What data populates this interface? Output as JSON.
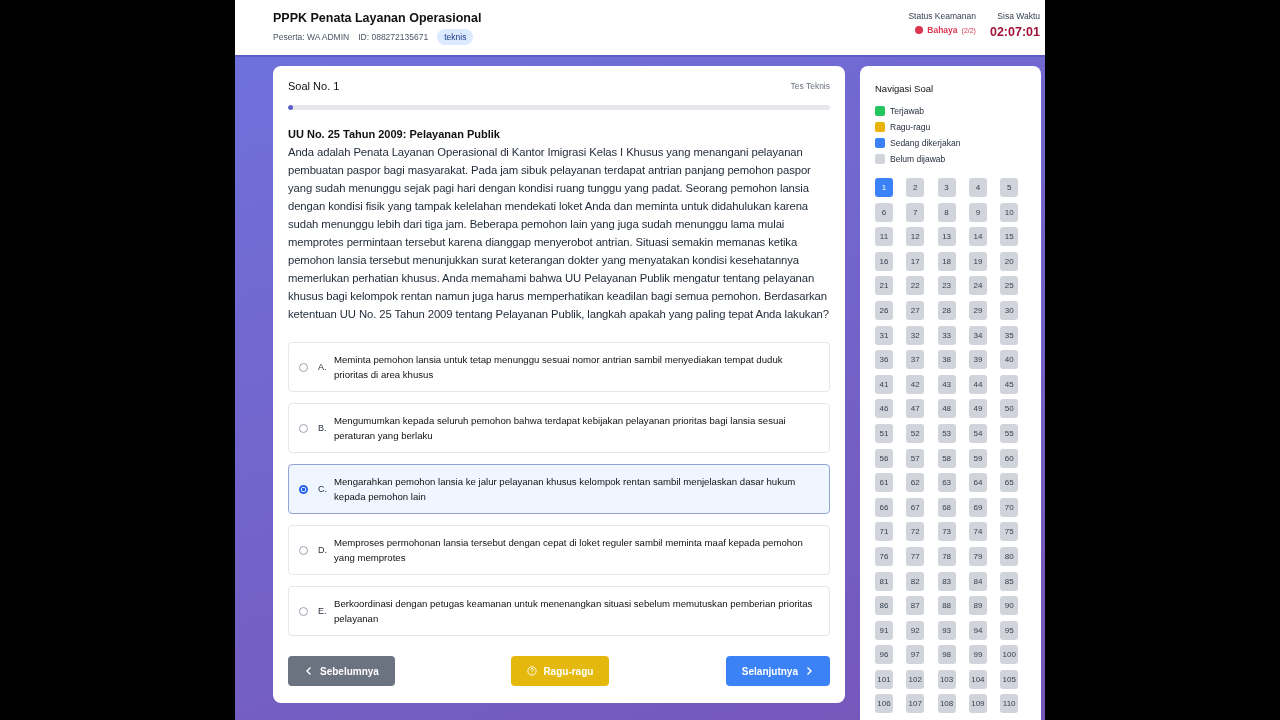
{
  "header": {
    "title": "PPPK Penata Layanan Operasional",
    "participant": "Peserta: WA ADMIN",
    "id": "ID: 088272135671",
    "tag": "teknis",
    "security": {
      "label": "Status Keamanan",
      "status": "Bahaya",
      "count": "(2/2)",
      "color": "#dc3552"
    },
    "time_label": "Sisa Waktu",
    "time": "02:07:01"
  },
  "question": {
    "number": "Soal No. 1",
    "category": "Tes Teknis",
    "progress": {
      "level": 0.01
    },
    "title": "UU No. 25 Tahun 2009: Pelayanan Publik",
    "text": "Anda adalah Penata Layanan Operasional di Kantor Imigrasi Kelas I Khusus yang menangani pelayanan pembuatan paspor bagi masyarakat. Pada jam sibuk pelayanan terdapat antrian panjang pemohon paspor yang sudah menunggu sejak pagi hari dengan kondisi ruang tunggu yang padat. Seorang pemohon lansia dengan kondisi fisik yang tampak kelelahan mendekati loket Anda dan meminta untuk didahulukan karena sudah menunggu lebih dari tiga jam. Beberapa pemohon lain yang juga sudah menunggu lama mulai memprotes permintaan tersebut karena dianggap menyerobot antrian. Situasi semakin memanas ketika pemohon lansia tersebut menunjukkan surat keterangan dokter yang menyatakan kondisi kesehatannya memerlukan perhatian khusus. Anda memahami bahwa UU Pelayanan Publik mengatur tentang pelayanan khusus bagi kelompok rentan namun juga harus memperhatikan keadilan bagi semua pemohon. Berdasarkan ketentuan UU No. 25 Tahun 2009 tentang Pelayanan Publik, langkah apakah yang paling tepat Anda lakukan?",
    "options": [
      {
        "letter": "A.",
        "text": "Meminta pemohon lansia untuk tetap menunggu sesuai nomor antrian sambil menyediakan tempat duduk prioritas di area khusus",
        "selected": false
      },
      {
        "letter": "B.",
        "text": "Mengumumkan kepada seluruh pemohon bahwa terdapat kebijakan pelayanan prioritas bagi lansia sesuai peraturan yang berlaku",
        "selected": false
      },
      {
        "letter": "C.",
        "text": "Mengarahkan pemohon lansia ke jalur pelayanan khusus kelompok rentan sambil menjelaskan dasar hukum kepada pemohon lain",
        "selected": true
      },
      {
        "letter": "D.",
        "text": "Memproses permohonan lansia tersebut dengan cepat di loket reguler sambil meminta maaf kepada pemohon yang memprotes",
        "selected": false
      },
      {
        "letter": "E.",
        "text": "Berkoordinasi dengan petugas keamanan untuk menenangkan situasi sebelum memutuskan pemberian prioritas pelayanan",
        "selected": false
      }
    ],
    "buttons": {
      "previous": "Sebelumnya",
      "doubt": "Ragu-ragu",
      "next": "Selanjutnya"
    }
  },
  "navigation": {
    "title": "Navigasi Soal",
    "legend": [
      {
        "label": "Terjawab",
        "color": "#22c55e"
      },
      {
        "label": "Ragu-ragu",
        "color": "#eab308"
      },
      {
        "label": "Sedang dikerjakan",
        "color": "#3b82f6"
      },
      {
        "label": "Belum dijawab",
        "color": "#d1d5db"
      }
    ],
    "items": [
      {
        "label": "1",
        "selected": true
      },
      {
        "label": "2",
        "selected": false
      },
      {
        "label": "3",
        "selected": false
      },
      {
        "label": "4",
        "selected": false
      },
      {
        "label": "5",
        "selected": false
      },
      {
        "label": "6",
        "selected": false
      },
      {
        "label": "7",
        "selected": false
      },
      {
        "label": "8",
        "selected": false
      },
      {
        "label": "9",
        "selected": false
      },
      {
        "label": "10",
        "selected": false
      },
      {
        "label": "11",
        "selected": false
      },
      {
        "label": "12",
        "selected": false
      },
      {
        "label": "13",
        "selected": false
      },
      {
        "label": "14",
        "selected": false
      },
      {
        "label": "15",
        "selected": false
      },
      {
        "label": "16",
        "selected": false
      },
      {
        "label": "17",
        "selected": false
      },
      {
        "label": "18",
        "selected": false
      },
      {
        "label": "19",
        "selected": false
      },
      {
        "label": "20",
        "selected": false
      },
      {
        "label": "21",
        "selected": false
      },
      {
        "label": "22",
        "selected": false
      },
      {
        "label": "23",
        "selected": false
      },
      {
        "label": "24",
        "selected": false
      },
      {
        "label": "25",
        "selected": false
      },
      {
        "label": "26",
        "selected": false
      },
      {
        "label": "27",
        "selected": false
      },
      {
        "label": "28",
        "selected": false
      },
      {
        "label": "29",
        "selected": false
      },
      {
        "label": "30",
        "selected": false
      },
      {
        "label": "31",
        "selected": false
      },
      {
        "label": "32",
        "selected": false
      },
      {
        "label": "33",
        "selected": false
      },
      {
        "label": "34",
        "selected": false
      },
      {
        "label": "35",
        "selected": false
      },
      {
        "label": "36",
        "selected": false
      },
      {
        "label": "37",
        "selected": false
      },
      {
        "label": "38",
        "selected": false
      },
      {
        "label": "39",
        "selected": false
      },
      {
        "label": "40",
        "selected": false
      },
      {
        "label": "41",
        "selected": false
      },
      {
        "label": "42",
        "selected": false
      },
      {
        "label": "43",
        "selected": false
      },
      {
        "label": "44",
        "selected": false
      },
      {
        "label": "45",
        "selected": false
      },
      {
        "label": "46",
        "selected": false
      },
      {
        "label": "47",
        "selected": false
      },
      {
        "label": "48",
        "selected": false
      },
      {
        "label": "49",
        "selected": false
      },
      {
        "label": "50",
        "selected": false
      },
      {
        "label": "51",
        "selected": false
      },
      {
        "label": "52",
        "selected": false
      },
      {
        "label": "53",
        "selected": false
      },
      {
        "label": "54",
        "selected": false
      },
      {
        "label": "55",
        "selected": false
      },
      {
        "label": "56",
        "selected": false
      },
      {
        "label": "57",
        "selected": false
      },
      {
        "label": "58",
        "selected": false
      },
      {
        "label": "59",
        "selected": false
      },
      {
        "label": "60",
        "selected": false
      },
      {
        "label": "61",
        "selected": false
      },
      {
        "label": "62",
        "selected": false
      },
      {
        "label": "63",
        "selected": false
      },
      {
        "label": "64",
        "selected": false
      },
      {
        "label": "65",
        "selected": false
      },
      {
        "label": "66",
        "selected": false
      },
      {
        "label": "67",
        "selected": false
      },
      {
        "label": "68",
        "selected": false
      },
      {
        "label": "69",
        "selected": false
      },
      {
        "label": "70",
        "selected": false
      },
      {
        "label": "71",
        "selected": false
      },
      {
        "label": "72",
        "selected": false
      },
      {
        "label": "73",
        "selected": false
      },
      {
        "label": "74",
        "selected": false
      },
      {
        "label": "75",
        "selected": false
      },
      {
        "label": "76",
        "selected": false
      },
      {
        "label": "77",
        "selected": false
      },
      {
        "label": "78",
        "selected": false
      },
      {
        "label": "79",
        "selected": false
      },
      {
        "label": "80",
        "selected": false
      },
      {
        "label": "81",
        "selected": false
      },
      {
        "label": "82",
        "selected": false
      },
      {
        "label": "83",
        "selected": false
      },
      {
        "label": "84",
        "selected": false
      },
      {
        "label": "85",
        "selected": false
      },
      {
        "label": "86",
        "selected": false
      },
      {
        "label": "87",
        "selected": false
      },
      {
        "label": "88",
        "selected": false
      },
      {
        "label": "89",
        "selected": false
      },
      {
        "label": "90",
        "selected": false
      },
      {
        "label": "91",
        "selected": false
      },
      {
        "label": "92",
        "selected": false
      },
      {
        "label": "93",
        "selected": false
      },
      {
        "label": "94",
        "selected": false
      },
      {
        "label": "95",
        "selected": false
      },
      {
        "label": "96",
        "selected": false
      },
      {
        "label": "97",
        "selected": false
      },
      {
        "label": "98",
        "selected": false
      },
      {
        "label": "99",
        "selected": false
      },
      {
        "label": "100",
        "selected": false
      },
      {
        "label": "101",
        "selected": false
      },
      {
        "label": "102",
        "selected": false
      },
      {
        "label": "103",
        "selected": false
      },
      {
        "label": "104",
        "selected": false
      },
      {
        "label": "105",
        "selected": false
      },
      {
        "label": "106",
        "selected": false
      },
      {
        "label": "107",
        "selected": false
      },
      {
        "label": "108",
        "selected": false
      },
      {
        "label": "109",
        "selected": false
      },
      {
        "label": "110",
        "selected": false
      }
    ]
  }
}
